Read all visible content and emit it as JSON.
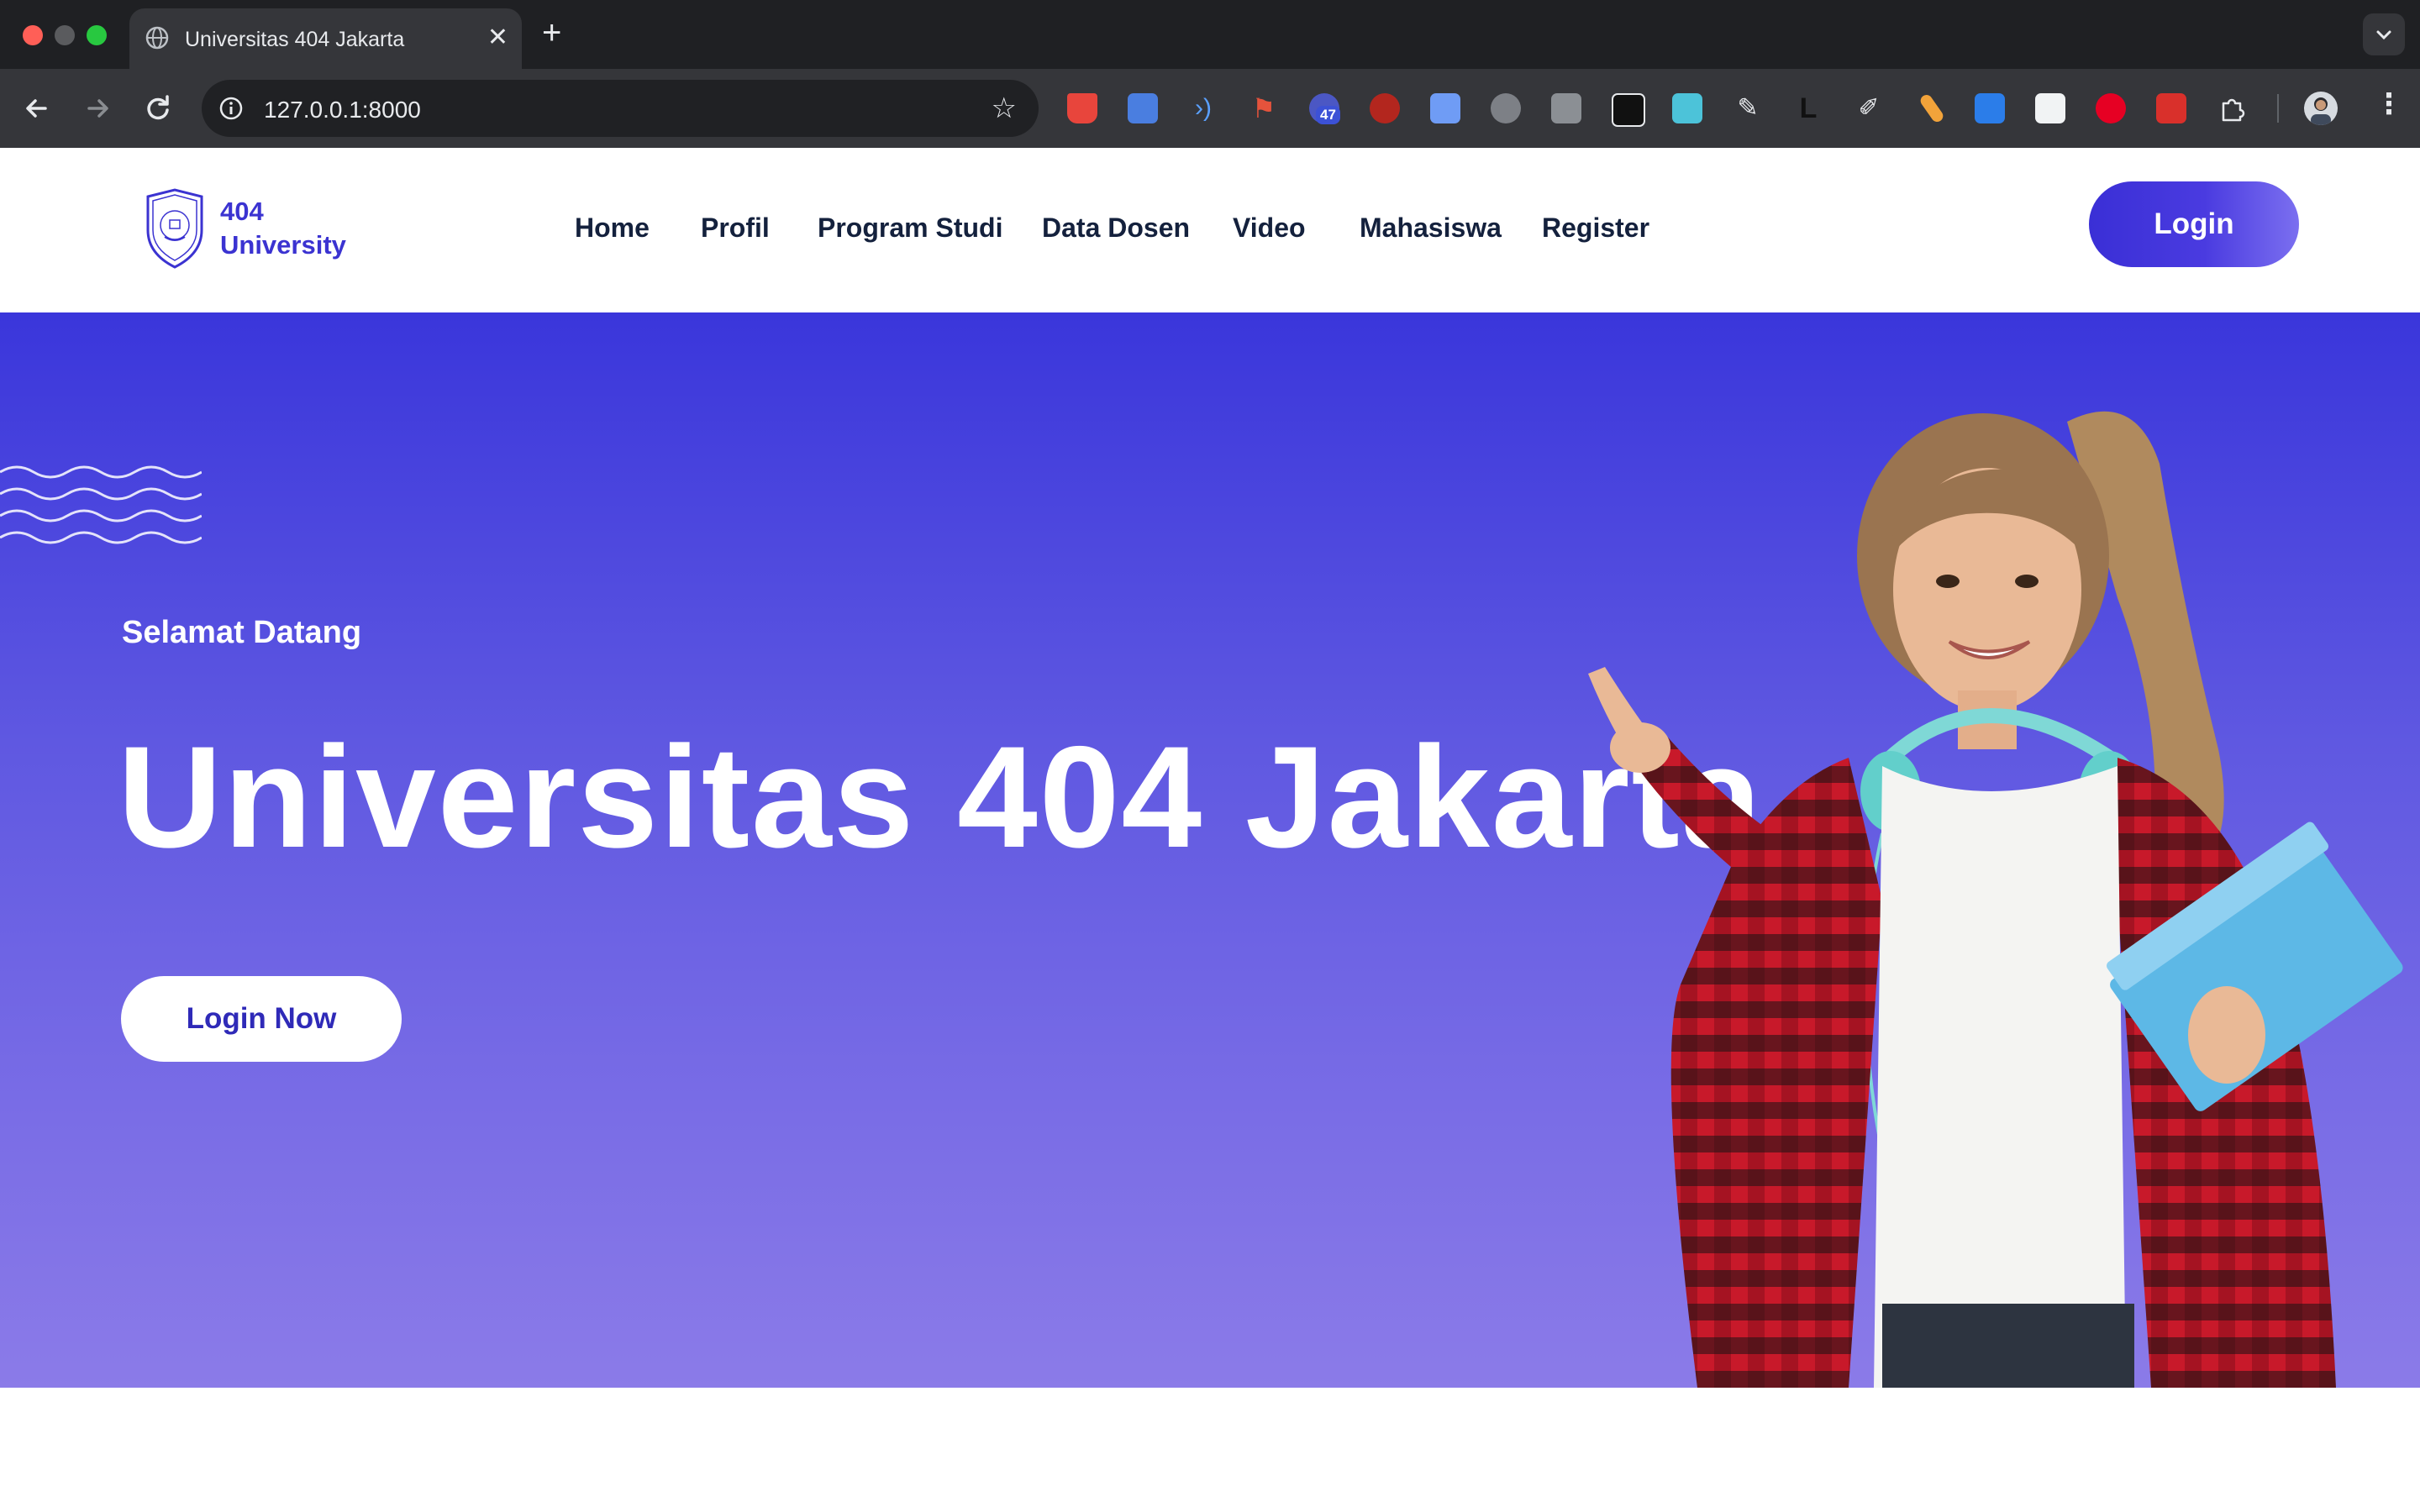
{
  "browser": {
    "tab_title": "Universitas 404 Jakarta",
    "tab_close": "✕",
    "new_tab": "+",
    "url": "127.0.0.1:8000",
    "star": "☆",
    "extension_badge": "47",
    "menu": "⋮"
  },
  "header": {
    "logo_line1": "404",
    "logo_line2": "University",
    "nav": [
      "Home",
      "Profil",
      "Program Studi",
      "Data Dosen",
      "Video",
      "Mahasiswa",
      "Register"
    ],
    "login_label": "Login"
  },
  "hero": {
    "greeting": "Selamat Datang",
    "headline": "Universitas 404 Jakarta",
    "cta_label": "Login Now"
  },
  "colors": {
    "brand": "#3b33d1",
    "nav_text": "#14213d",
    "hero_top": "#3a36db",
    "hero_bottom": "#8b7be8"
  }
}
